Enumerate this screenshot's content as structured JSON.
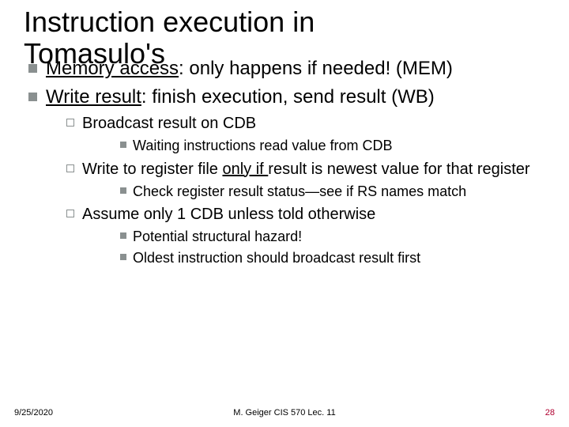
{
  "title_line1": "Instruction execution in",
  "title_line2": "Tomasulo's",
  "bullets": {
    "b1_pre": "Memory access",
    "b1_post": ": only happens if needed! (MEM)",
    "b2_pre": "Write result",
    "b2_post": ": finish execution, send result (WB)",
    "s1": "Broadcast result on CDB",
    "s1a": "Waiting instructions read value from CDB",
    "s2_pre": "Write to register file ",
    "s2_u": "only if ",
    "s2_post": "result is newest value for that register",
    "s2a": "Check register result status—see if RS names match",
    "s3": "Assume only 1 CDB unless told otherwise",
    "s3a": "Potential structural hazard!",
    "s3b": "Oldest instruction should broadcast result first"
  },
  "footer": {
    "date": "9/25/2020",
    "center": "M. Geiger   CIS 570   Lec. 11",
    "page": "28"
  }
}
